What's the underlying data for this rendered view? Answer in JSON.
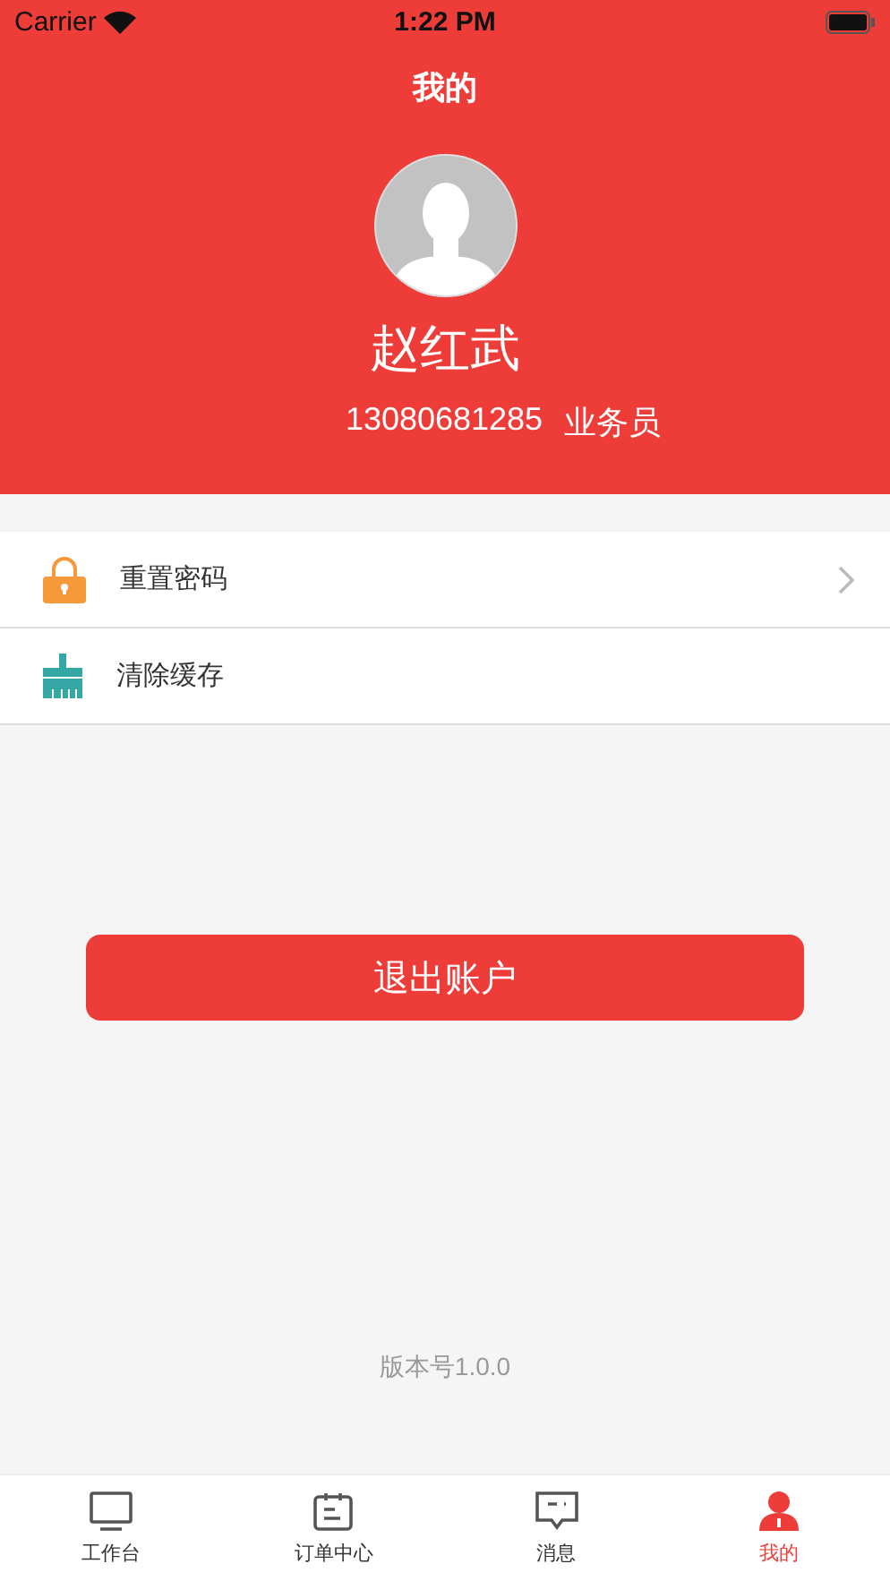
{
  "status_bar": {
    "carrier": "Carrier",
    "time": "1:22 PM"
  },
  "header": {
    "title": "我的",
    "name": "赵红武",
    "phone": "13080681285",
    "role": "业务员"
  },
  "menu": [
    {
      "kind": "lock",
      "label": "重置密码",
      "chevron": true
    },
    {
      "kind": "broom",
      "label": "清除缓存",
      "chevron": false
    }
  ],
  "logout_button": "退出账户",
  "version": "版本号1.0.0",
  "tabs": [
    {
      "kind": "monitor",
      "label": "工作台",
      "selected": false
    },
    {
      "kind": "calendar",
      "label": "订单中心",
      "selected": false
    },
    {
      "kind": "message",
      "label": "消息",
      "selected": false
    },
    {
      "kind": "person",
      "label": "我的",
      "selected": true
    }
  ]
}
